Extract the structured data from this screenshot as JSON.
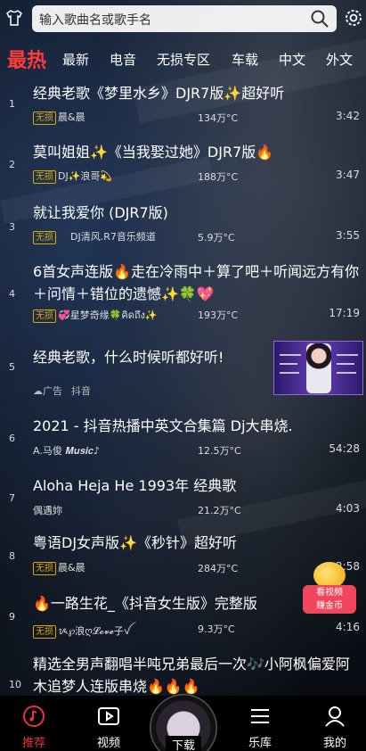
{
  "search": {
    "placeholder": "输入歌曲名或歌手名"
  },
  "categories": [
    {
      "label": "最热",
      "active": true
    },
    {
      "label": "最新"
    },
    {
      "label": "电音"
    },
    {
      "label": "无损专区"
    },
    {
      "label": "车载"
    },
    {
      "label": "中文"
    },
    {
      "label": "外文"
    }
  ],
  "songs": [
    {
      "rank": "1",
      "title": "经典老歌《梦里水乡》DJR7版✨超好听",
      "badge": "无损",
      "artist": "晨&晨",
      "plays": "134万°C",
      "duration": "3:42"
    },
    {
      "rank": "2",
      "title": "莫叫姐姐✨《当我娶过她》DJR7版🔥",
      "badge": "无损",
      "artist": "DJ✨浪哥💫",
      "plays": "188万°C",
      "duration": "3:47"
    },
    {
      "rank": "3",
      "title": "就让我爱你 (DJR7版)",
      "badge": "无损",
      "artist": "DJ清风.R7音乐频道",
      "plays": "5.9万°C",
      "duration": "3:55"
    },
    {
      "rank": "4",
      "title": "6首女声连版🔥走在冷雨中＋算了吧＋听闻远方有你＋问情＋错位的遗憾✨🍀💖",
      "badge": "无损",
      "artist": "💞星梦奇缘🍀คิดถึง✨",
      "plays": "193万°C",
      "duration": "17:19"
    },
    {
      "rank": "5",
      "title": "经典老歌，什么时候听都好听!",
      "ad_label": "☁广告",
      "artist": "抖音"
    },
    {
      "rank": "6",
      "title": "2021 - 抖音热播中英文合集篇 Dj大串烧.",
      "artist": "A.马俊 𝑴𝒖𝒔𝒊𝒄♪",
      "plays": "12.5万°C",
      "duration": "54:28"
    },
    {
      "rank": "7",
      "title": "Aloha Heja He 1993年 经典歌",
      "artist": "偶遇妳",
      "plays": "21.2万°C",
      "duration": "4:03"
    },
    {
      "rank": "8",
      "title": "粤语DJ女声版✨《秒针》超好听",
      "badge": "无损",
      "artist": "晨&晨",
      "plays": "284万°C",
      "duration": "2:58"
    },
    {
      "rank": "9",
      "title": "🔥一路生花_《抖音女生版》完整版",
      "badge": "无损",
      "artist": "ᝰ℘浪ღ𝓛𝓸𝓿𝓮子ꪜ",
      "plays": "9.3万°C",
      "duration": "4:16"
    },
    {
      "rank": "10",
      "title": "精选全男声翻唱半吨兄弟最后一次🎶小阿枫偏爱阿木追梦人连版串烧🔥🔥🔥"
    }
  ],
  "bonus": {
    "line1": "看视频",
    "line2": "赚金币"
  },
  "tabbar": [
    {
      "label": "推荐",
      "icon": "music-note-icon",
      "active": true
    },
    {
      "label": "视频",
      "icon": "video-icon"
    },
    {
      "label": "下载",
      "icon": "disc-icon"
    },
    {
      "label": "乐库",
      "icon": "library-icon"
    },
    {
      "label": "我的",
      "icon": "user-icon"
    }
  ],
  "colors": {
    "accent": "#e8333c",
    "badge": "#d9a700",
    "active_category": "#ff3a3a"
  }
}
